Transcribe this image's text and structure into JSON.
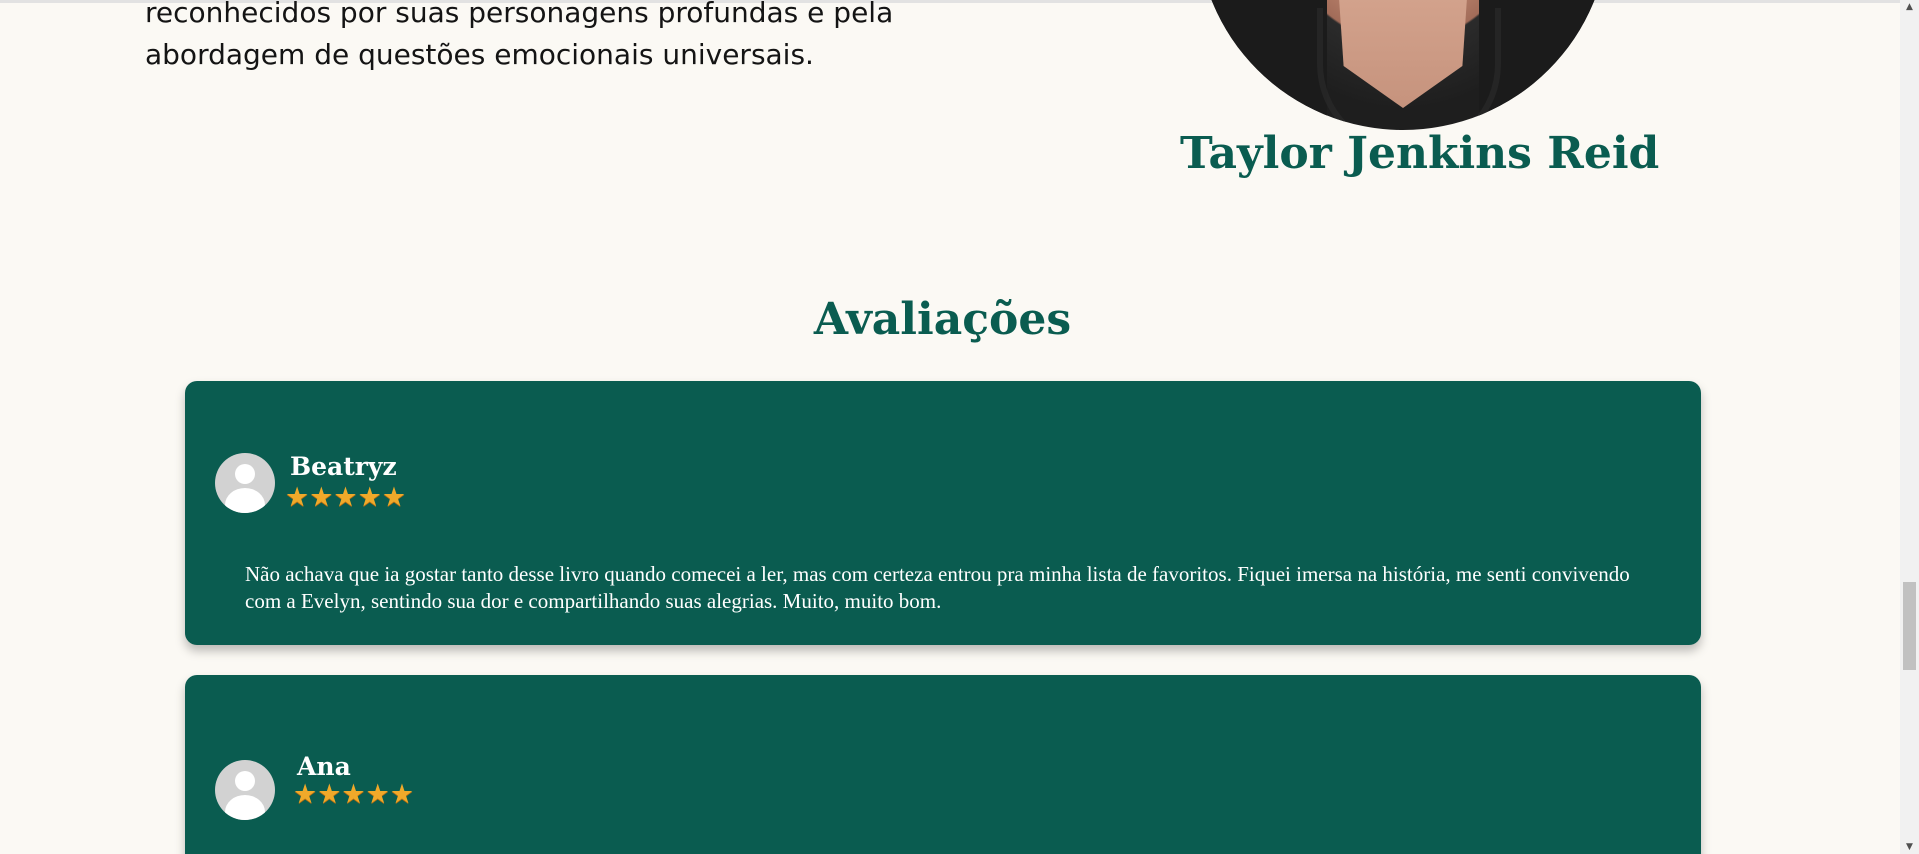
{
  "about": {
    "text": "reconhecidos por suas personagens profundas e pela abordagem de questões emocionais universais."
  },
  "author": {
    "name": "Taylor Jenkins Reid"
  },
  "reviews_section": {
    "title": "Avaliações",
    "reviews": [
      {
        "name": "Beatryz",
        "rating": 5,
        "stars": "★★★★★",
        "text": "Não achava que ia gostar tanto desse livro quando comecei a ler, mas com certeza entrou pra minha lista de favoritos. Fiquei imersa na história, me senti convivendo com a Evelyn, sentindo sua dor e compartilhando suas alegrias. Muito, muito bom."
      },
      {
        "name": "Ana",
        "rating": 5,
        "stars": "★★★★★"
      }
    ]
  },
  "colors": {
    "accent": "#0a5c50",
    "background": "#fbf9f4",
    "star": "#f0a92a"
  }
}
